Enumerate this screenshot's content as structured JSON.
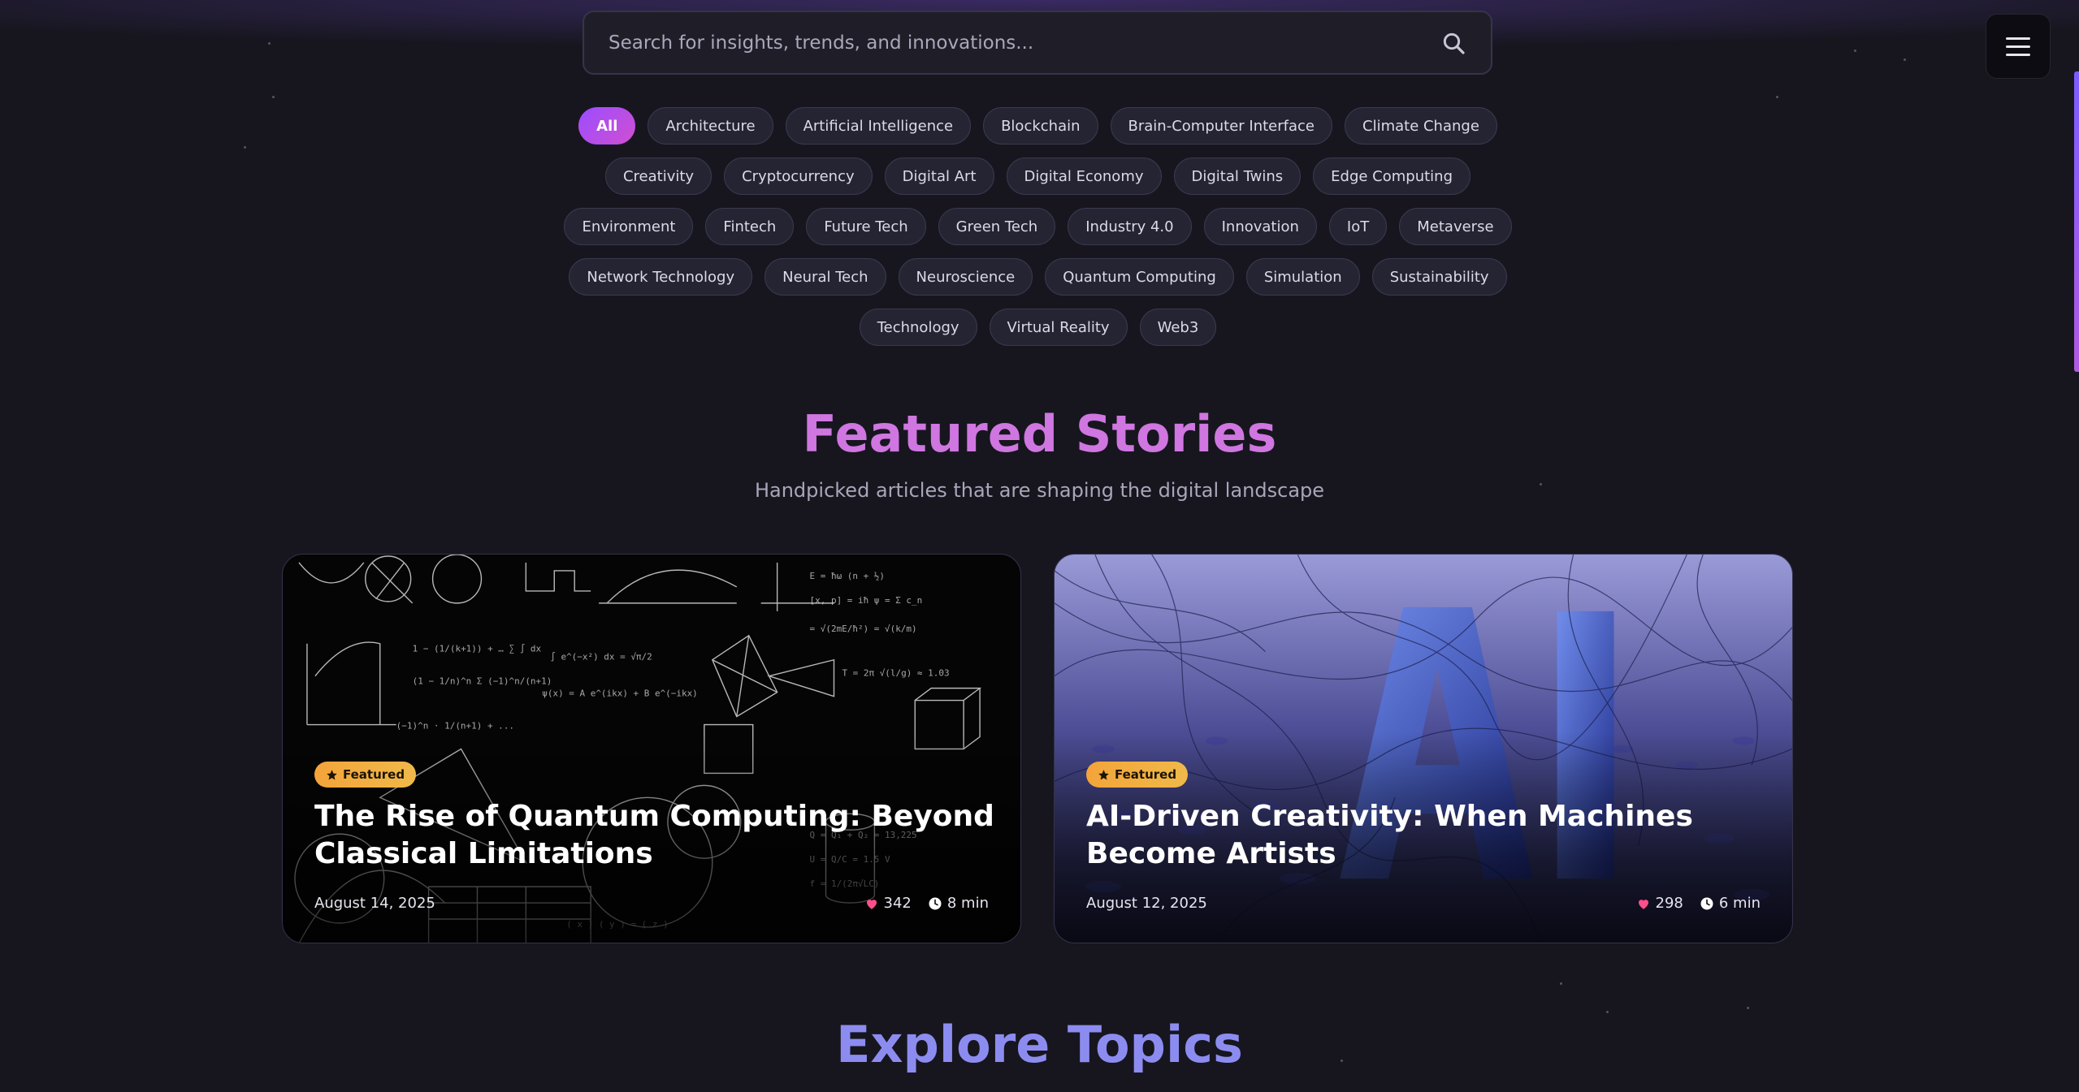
{
  "search": {
    "placeholder": "Search for insights, trends, and innovations..."
  },
  "categories": {
    "rows": [
      [
        "All",
        "Architecture",
        "Artificial Intelligence",
        "Blockchain",
        "Brain-Computer Interface",
        "Climate Change"
      ],
      [
        "Creativity",
        "Cryptocurrency",
        "Digital Art",
        "Digital Economy",
        "Digital Twins",
        "Edge Computing"
      ],
      [
        "Environment",
        "Fintech",
        "Future Tech",
        "Green Tech",
        "Industry 4.0",
        "Innovation",
        "IoT",
        "Metaverse"
      ],
      [
        "Network Technology",
        "Neural Tech",
        "Neuroscience",
        "Quantum Computing",
        "Simulation",
        "Sustainability"
      ],
      [
        "Technology",
        "Virtual Reality",
        "Web3"
      ]
    ],
    "active": "All"
  },
  "featured": {
    "title": "Featured Stories",
    "subtitle": "Handpicked articles that are shaping the digital landscape",
    "cards": [
      {
        "badge": "Featured",
        "title": "The Rise of Quantum Computing: Beyond Classical Limitations",
        "date": "August 14, 2025",
        "likes": "342",
        "read_time": "8 min"
      },
      {
        "badge": "Featured",
        "title": "AI-Driven Creativity: When Machines Become Artists",
        "date": "August 12, 2025",
        "likes": "298",
        "read_time": "6 min"
      }
    ]
  },
  "explore": {
    "title": "Explore Topics"
  },
  "colors": {
    "accent_purple": "#9b4dff",
    "accent_pink": "#d04fd2",
    "featured_heading": "#cf76e0",
    "explore_heading": "#8c8cf0",
    "badge_orange": "#f3a43a",
    "heart": "#ff4f8b"
  },
  "icons": {
    "search": "search-icon",
    "menu": "hamburger-menu-icon",
    "badge": "star-icon",
    "likes": "heart-icon",
    "read_time": "clock-icon"
  }
}
